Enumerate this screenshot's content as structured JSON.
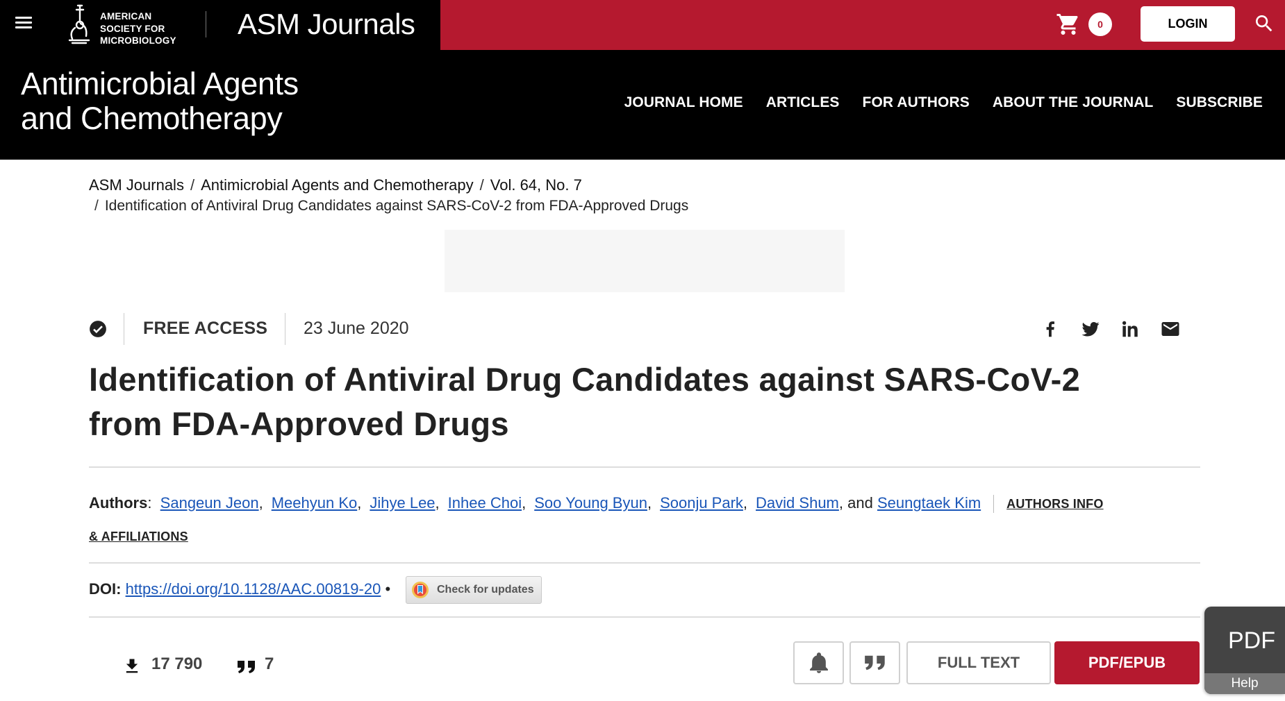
{
  "topbar": {
    "society_lines": [
      "AMERICAN",
      "SOCIETY FOR",
      "MICROBIOLOGY"
    ],
    "brand": "ASM Journals",
    "cart_count": "0",
    "login_label": "LOGIN",
    "colors": {
      "background": "#000000",
      "accent": "#b5192f"
    }
  },
  "journal": {
    "title_line1": "Antimicrobial Agents",
    "title_line2": "and Chemotherapy",
    "nav": [
      "JOURNAL HOME",
      "ARTICLES",
      "FOR AUTHORS",
      "ABOUT THE JOURNAL",
      "SUBSCRIBE"
    ]
  },
  "breadcrumb": {
    "items": [
      "ASM Journals",
      "Antimicrobial Agents and Chemotherapy",
      "Vol. 64, No. 7"
    ],
    "current": "Identification of Antiviral Drug Candidates against SARS-CoV-2 from FDA-Approved Drugs"
  },
  "article": {
    "access": "FREE ACCESS",
    "date": "23 June 2020",
    "share_icons": [
      "facebook-icon",
      "twitter-icon",
      "linkedin-icon",
      "email-icon"
    ],
    "title_line1": "Identification of Antiviral Drug Candidates against SARS-CoV-2",
    "title_line2": "from FDA-Approved Drugs",
    "authors_label": "Authors",
    "authors": [
      "Sangeun Jeon",
      "Meehyun Ko",
      "Jihye Lee",
      "Inhee Choi",
      "Soo Young Byun",
      "Soonju Park",
      "David Shum",
      "Seungtaek Kim"
    ],
    "and_word": "and",
    "affiliations_label_1": "AUTHORS INFO",
    "affiliations_label_2": "& AFFILIATIONS",
    "doi_label": "DOI:",
    "doi_url": "https://doi.org/10.1128/AAC.00819-20",
    "check_updates_label": "Check for updates"
  },
  "metrics": {
    "downloads": "17 790",
    "citations": "7"
  },
  "actions": {
    "full_text": "FULL TEXT",
    "pdf_epub": "PDF/EPUB"
  },
  "widget": {
    "pdf": "PDF",
    "help": "Help"
  }
}
